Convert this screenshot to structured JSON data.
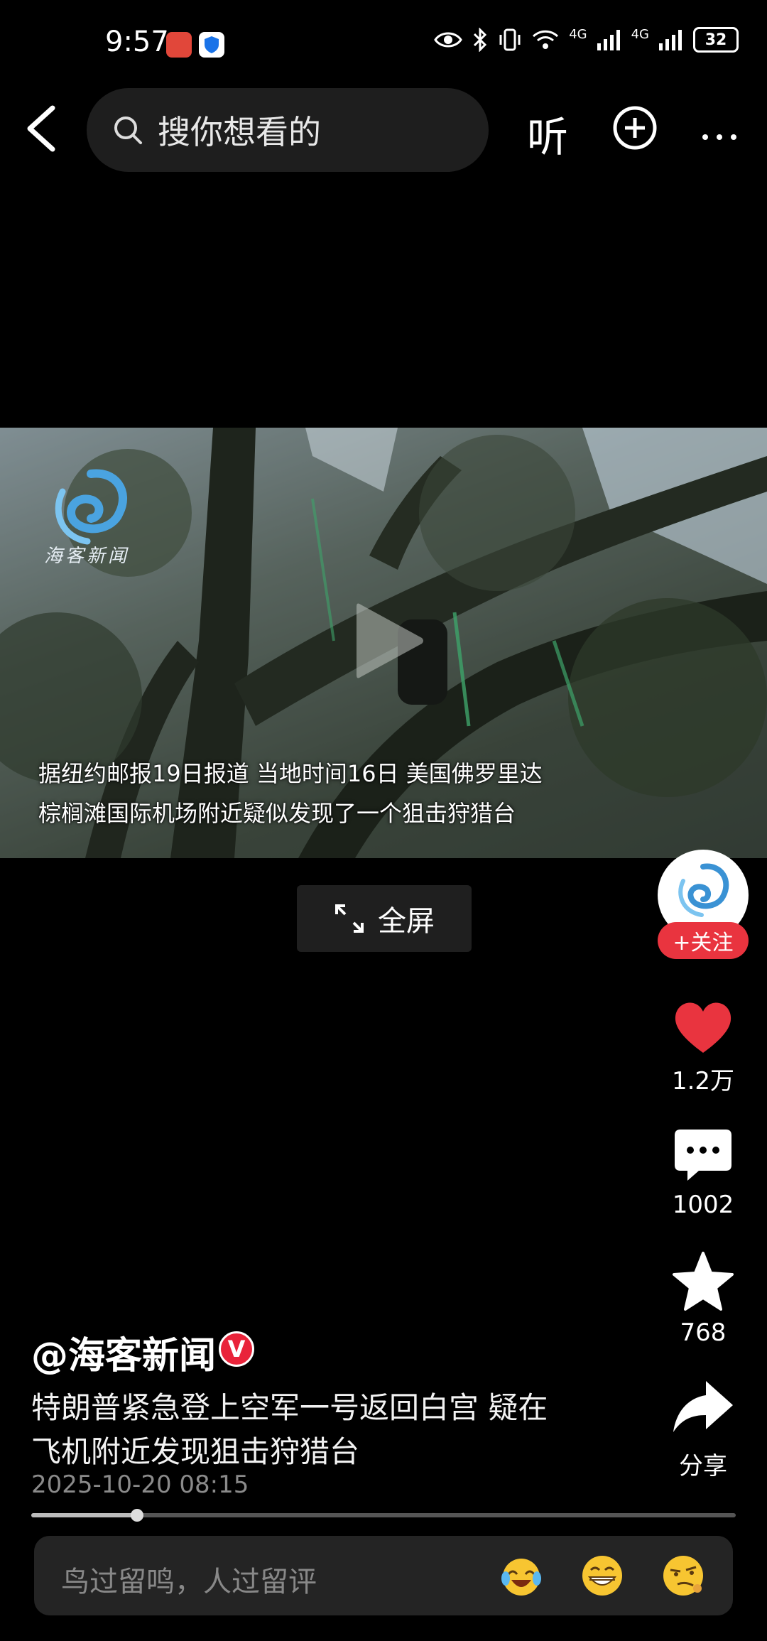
{
  "status_bar": {
    "time": "9:57",
    "network_1": "4G",
    "network_2": "4G",
    "battery": "32"
  },
  "top_bar": {
    "search_placeholder": "搜你想看的",
    "listen_label": "听"
  },
  "video": {
    "caption_line1": "据纽约邮报19日报道  当地时间16日  美国佛罗里达",
    "caption_line2": "棕榈滩国际机场附近疑似发现了一个狙击狩猎台",
    "watermark_text": "海客新闻",
    "fullscreen_label": "全屏"
  },
  "right_rail": {
    "follow_label": "+关注",
    "like_count": "1.2万",
    "comment_count": "1002",
    "favorite_count": "768",
    "share_label": "分享",
    "like_color": "#e9343f"
  },
  "post": {
    "author": "@海客新闻",
    "verified_mark": "V",
    "title_line1": "特朗普紧急登上空军一号返回白宫 疑在",
    "title_line2": "飞机附近发现狙击狩猎台",
    "timestamp": "2025-10-20 08:15"
  },
  "playback": {
    "progress_fraction": 0.15
  },
  "comment_bar": {
    "placeholder": "鸟过留鸣，人过留评"
  }
}
